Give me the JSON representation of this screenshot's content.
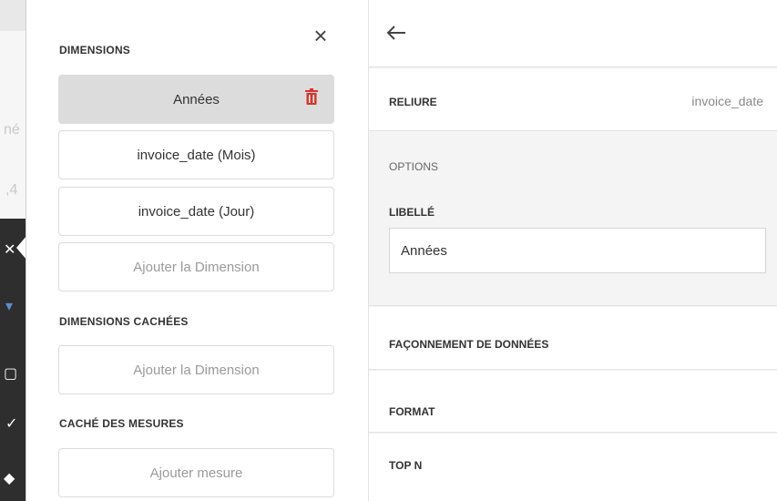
{
  "left_panel": {
    "dimensions_title": "DIMENSIONS",
    "dimensions": [
      {
        "label": "Années",
        "selected": true
      },
      {
        "label": "invoice_date (Mois)",
        "selected": false
      },
      {
        "label": "invoice_date (Jour)",
        "selected": false
      }
    ],
    "add_dimension_label": "Ajouter la Dimension",
    "hidden_dimensions_title": "DIMENSIONS CACHÉES",
    "add_hidden_dimension_label": "Ajouter la Dimension",
    "hidden_measures_title": "CACHÉ DES MESURES",
    "add_measure_label": "Ajouter mesure"
  },
  "right_panel": {
    "binding_label": "RELIURE",
    "binding_value": "invoice_date",
    "options_title": "OPTIONS",
    "label_field_label": "LIBELLÉ",
    "label_field_value": "Années",
    "data_shaping_label": "FAÇONNEMENT DE DONNÉES",
    "format_label": "FORMAT",
    "top_n_label": "TOP N"
  },
  "background": {
    "fragment_1": "né",
    "fragment_2": ",4"
  },
  "colors": {
    "accent_delete": "#d9342b",
    "selected_bg": "#dcdcdc",
    "panel_bg": "#f4f4f4"
  },
  "icons": {
    "close": "close-icon",
    "delete": "trash-icon",
    "back": "arrow-left-icon"
  }
}
